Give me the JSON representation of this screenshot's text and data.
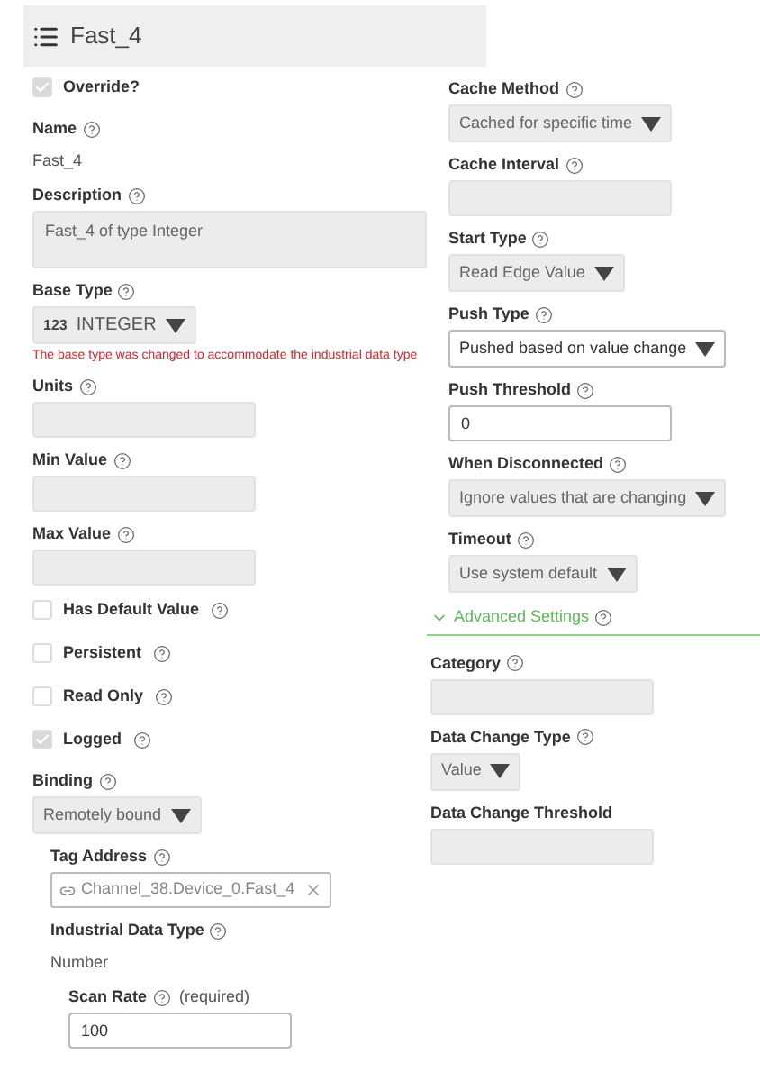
{
  "header": {
    "title": "Fast_4"
  },
  "left": [
    {
      "kind": "checkbox",
      "label": "Override?",
      "checked": true,
      "help": false
    },
    {
      "kind": "text",
      "label": "Name",
      "help": true,
      "value": "Fast_4"
    },
    {
      "kind": "textarea",
      "label": "Description",
      "help": true,
      "value": "Fast_4 of type Integer",
      "disabled": true
    },
    {
      "kind": "select",
      "label": "Base Type",
      "help": true,
      "prefix": "123",
      "value": "INTEGER",
      "disabled": true,
      "message": "The base type was changed to accommodate the industrial data type"
    },
    {
      "kind": "input",
      "label": "Units",
      "help": true,
      "disabled": true
    },
    {
      "kind": "input",
      "label": "Min Value",
      "help": true,
      "disabled": true
    },
    {
      "kind": "input",
      "label": "Max Value",
      "help": true,
      "disabled": true
    },
    {
      "kind": "checkbox",
      "label": "Has Default Value",
      "checked": false,
      "help": true
    },
    {
      "kind": "checkbox",
      "label": "Persistent",
      "checked": false,
      "help": true
    },
    {
      "kind": "checkbox",
      "label": "Read Only",
      "checked": false,
      "help": true
    },
    {
      "kind": "checkbox",
      "label": "Logged",
      "checked": true,
      "help": true
    },
    {
      "kind": "select",
      "label": "Binding",
      "help": true,
      "value": "Remotely bound",
      "disabled": true,
      "children": [
        {
          "kind": "tag",
          "label": "Tag Address",
          "help": true,
          "value": "Channel_38.Device_0.Fast_4",
          "disabled": false
        },
        {
          "kind": "text",
          "label": "Industrial Data Type",
          "help": true,
          "value": "Number",
          "children": [
            {
              "kind": "input",
              "label": "Scan Rate",
              "help": true,
              "note": "(required)",
              "value": "100",
              "disabled": false
            }
          ]
        }
      ]
    }
  ],
  "right": [
    {
      "kind": "select",
      "label": "Cache Method",
      "help": true,
      "value": "Cached for specific time",
      "disabled": true
    },
    {
      "kind": "input",
      "label": "Cache Interval",
      "help": true,
      "disabled": true
    },
    {
      "kind": "select",
      "label": "Start Type",
      "help": true,
      "value": "Read Edge Value",
      "disabled": true
    },
    {
      "kind": "select",
      "label": "Push Type",
      "help": true,
      "value": "Pushed based on value change",
      "disabled": false
    },
    {
      "kind": "input",
      "label": "Push Threshold",
      "help": true,
      "value": "0",
      "disabled": false
    },
    {
      "kind": "select",
      "label": "When Disconnected",
      "help": true,
      "value": "Ignore values that are changing",
      "disabled": true
    },
    {
      "kind": "select",
      "label": "Timeout",
      "help": true,
      "value": "Use system default",
      "disabled": true
    }
  ],
  "advanced": {
    "label": "Advanced Settings",
    "help": true,
    "expanded": true,
    "fields": [
      {
        "kind": "input",
        "label": "Category",
        "help": true,
        "disabled": true
      },
      {
        "kind": "select",
        "label": "Data Change Type",
        "help": true,
        "value": "Value",
        "disabled": true
      },
      {
        "kind": "input",
        "label": "Data Change Threshold",
        "help": false,
        "disabled": true
      }
    ]
  }
}
